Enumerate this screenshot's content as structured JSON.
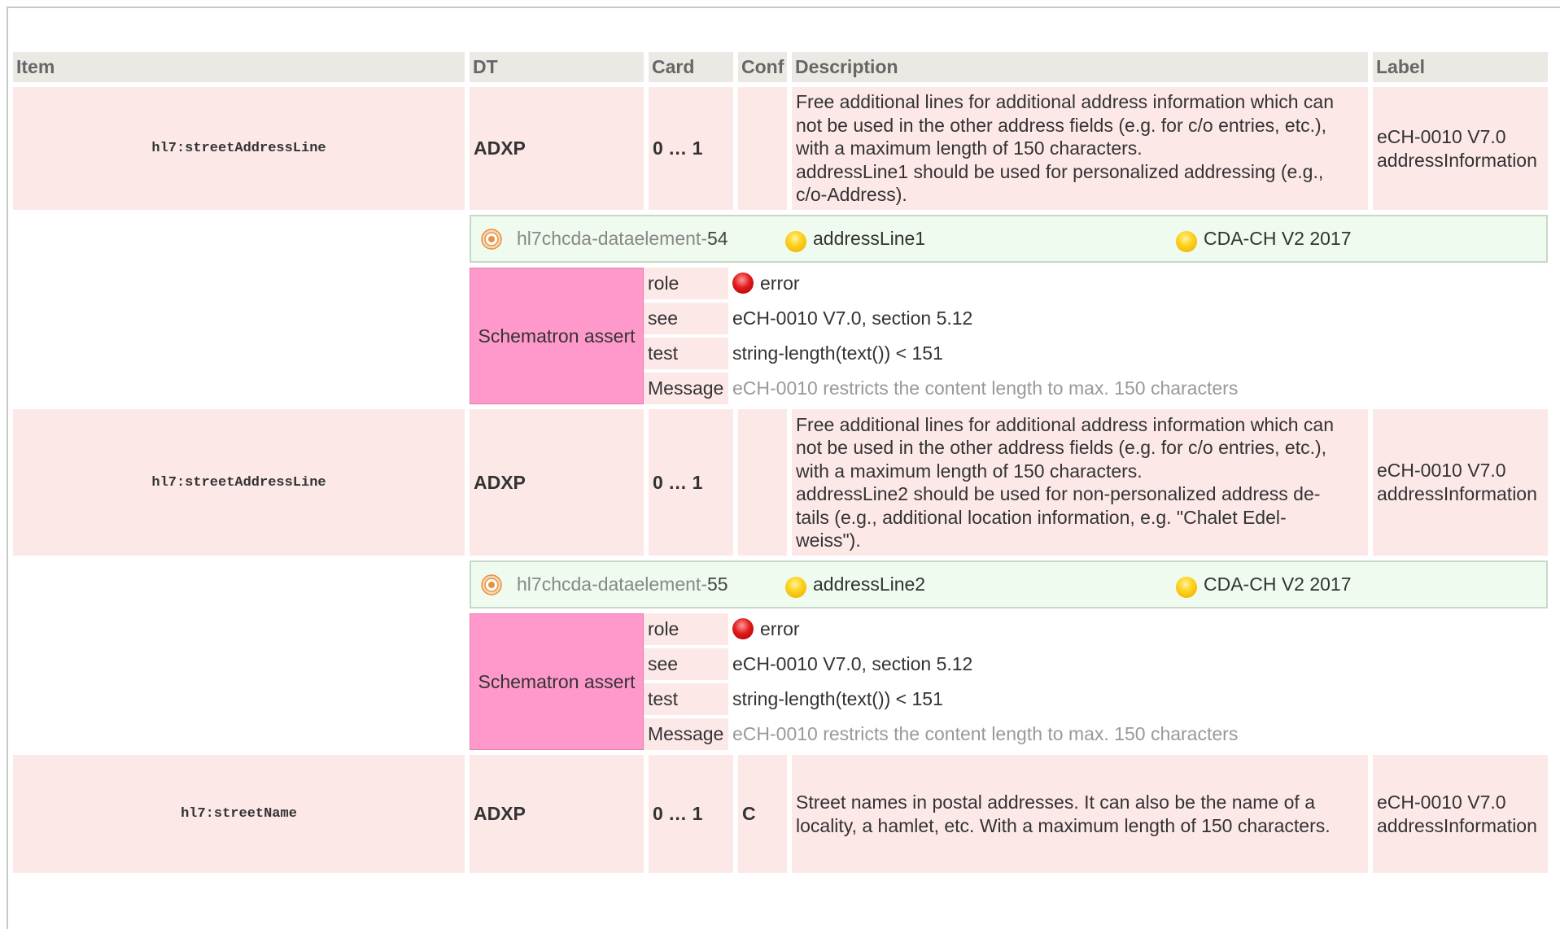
{
  "header": {
    "item": "Item",
    "dt": "DT",
    "card": "Card",
    "conf": "Conf",
    "description": "Description",
    "label": "Label"
  },
  "rows": [
    {
      "item": "hl7:streetAddressLine",
      "dt": "ADXP",
      "card": "0 … 1",
      "conf": "",
      "description": [
        "Free additional lines for additional address information which can",
        "not be used in the other address fields (e.g. for c/o entries, etc.),",
        "with a maximum length of 150 characters.",
        "addressLine1 should be used for personalized addressing (e.g.,",
        "c/o-Address)."
      ],
      "label": [
        "eCH-0010 V7.0",
        "addressInformation"
      ],
      "assoc": {
        "id_prefix": "hl7chcda-dataelement-",
        "id_num": "54",
        "name": "addressLine1",
        "set": "CDA-CH V2 2017"
      },
      "schematron": {
        "title": "Schematron assert",
        "role_key": "role",
        "role_val": "error",
        "see_key": "see",
        "see_val": "eCH-0010 V7.0, section 5.12",
        "test_key": "test",
        "test_val": "string-length(text()) < 151",
        "msg_key": "Message",
        "msg_val": "eCH-0010 restricts the content length to max. 150 characters"
      }
    },
    {
      "item": "hl7:streetAddressLine",
      "dt": "ADXP",
      "card": "0 … 1",
      "conf": "",
      "description": [
        "Free additional lines for additional address information which can",
        "not be used in the other address fields (e.g. for c/o entries, etc.),",
        "with a maximum length of 150 characters.",
        "addressLine2 should be used for non-personalized address de-",
        "tails (e.g., additional location information, e.g. \"Chalet Edel-",
        "weiss\")."
      ],
      "label": [
        "eCH-0010 V7.0",
        "addressInformation"
      ],
      "assoc": {
        "id_prefix": "hl7chcda-dataelement-",
        "id_num": "55",
        "name": "addressLine2",
        "set": "CDA-CH V2 2017"
      },
      "schematron": {
        "title": "Schematron assert",
        "role_key": "role",
        "role_val": "error",
        "see_key": "see",
        "see_val": "eCH-0010 V7.0, section 5.12",
        "test_key": "test",
        "test_val": "string-length(text()) < 151",
        "msg_key": "Message",
        "msg_val": "eCH-0010 restricts the content length to max. 150 characters"
      }
    },
    {
      "item": "hl7:streetName",
      "dt": "ADXP",
      "card": "0 … 1",
      "conf": "C",
      "description": [
        "Street names in postal addresses. It can also be the name of a",
        "locality, a hamlet, etc. With a maximum length of 150 characters."
      ],
      "label": [
        "eCH-0010 V7.0",
        "addressInformation"
      ]
    }
  ],
  "colors": {
    "header_bg": "#ece9e4",
    "row_bg": "#fde8e8",
    "assoc_bg": "#eefbee",
    "schematron_bg": "#ff99cc"
  },
  "icons": {
    "target": "target-icon",
    "status_yellow": "yellow-status-dot-icon",
    "error": "red-error-dot-icon"
  }
}
